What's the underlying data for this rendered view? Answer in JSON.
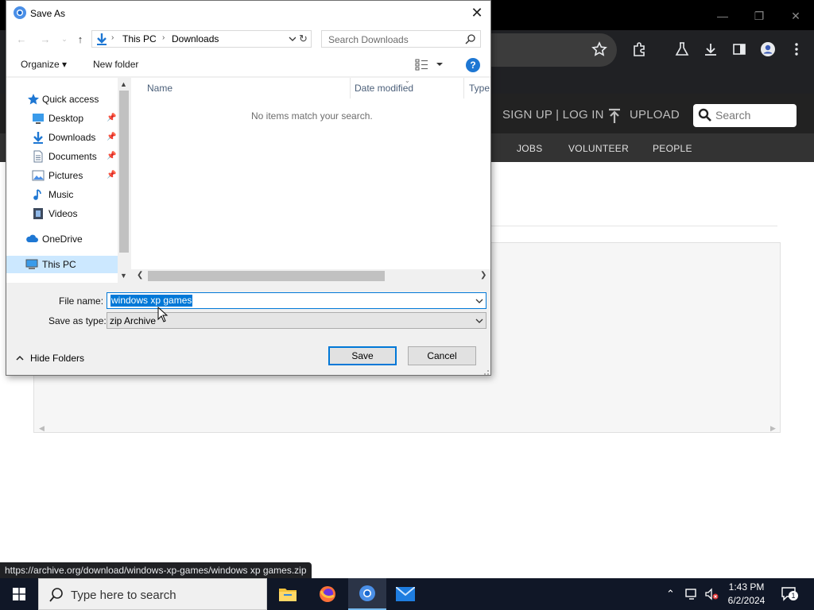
{
  "colors": {
    "accent": "#0078d7",
    "selection_bg": "#cce8ff",
    "browser_dark": "#202124",
    "taskbar": "#101727"
  },
  "browser": {
    "site": {
      "signup_login": "SIGN UP | LOG IN",
      "upload": "UPLOAD",
      "search_placeholder": "Search",
      "nav": [
        "JOBS",
        "VOLUNTEER",
        "PEOPLE"
      ]
    },
    "status_url": "https://archive.org/download/windows-xp-games/windows xp games.zip"
  },
  "dialog": {
    "title": "Save As",
    "breadcrumb": [
      "This PC",
      "Downloads"
    ],
    "search_placeholder": "Search Downloads",
    "toolbar": {
      "organize": "Organize ▾",
      "new_folder": "New folder",
      "help": "?"
    },
    "nav_pane": {
      "items": [
        {
          "label": "Quick access",
          "icon": "star-icon"
        },
        {
          "label": "Desktop",
          "icon": "desktop-icon",
          "pinned": true
        },
        {
          "label": "Downloads",
          "icon": "download-icon",
          "pinned": true
        },
        {
          "label": "Documents",
          "icon": "document-icon",
          "pinned": true
        },
        {
          "label": "Pictures",
          "icon": "pictures-icon",
          "pinned": true
        },
        {
          "label": "Music",
          "icon": "music-icon"
        },
        {
          "label": "Videos",
          "icon": "videos-icon"
        },
        {
          "label": "OneDrive",
          "icon": "cloud-icon"
        },
        {
          "label": "This PC",
          "icon": "computer-icon",
          "selected": true
        }
      ]
    },
    "file_list": {
      "columns": [
        "Name",
        "Date modified",
        "Type"
      ],
      "empty_message": "No items match your search."
    },
    "file_name_label": "File name:",
    "file_name_value": "windows xp games",
    "save_type_label": "Save as type:",
    "save_type_value": "zip Archive",
    "hide_folders": "Hide Folders",
    "save_label": "Save",
    "cancel_label": "Cancel"
  },
  "taskbar": {
    "search_placeholder": "Type here to search",
    "time": "1:43 PM",
    "date": "6/2/2024",
    "notification_count": "1"
  }
}
